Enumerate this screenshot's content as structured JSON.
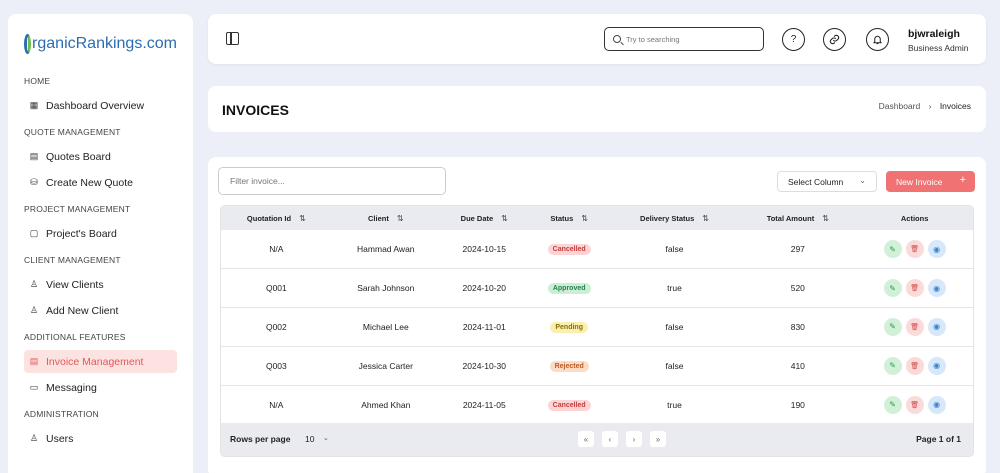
{
  "brand": {
    "logo_text": "rganicRankings.com"
  },
  "sidebar": {
    "sections": [
      {
        "title": "HOME",
        "items": [
          {
            "label": "Dashboard Overview",
            "icon": "grid-icon"
          }
        ]
      },
      {
        "title": "QUOTE MANAGEMENT",
        "items": [
          {
            "label": "Quotes Board",
            "icon": "board-icon"
          },
          {
            "label": "Create New Quote",
            "icon": "database-icon"
          }
        ]
      },
      {
        "title": "PROJECT MANAGEMENT",
        "items": [
          {
            "label": "Project's Board",
            "icon": "clipboard-icon"
          }
        ]
      },
      {
        "title": "CLIENT MANAGEMENT",
        "items": [
          {
            "label": "View Clients",
            "icon": "user-icon"
          },
          {
            "label": "Add New Client",
            "icon": "user-plus-icon"
          }
        ]
      },
      {
        "title": "ADDITIONAL FEATURES",
        "items": [
          {
            "label": "Invoice Management",
            "icon": "invoice-icon",
            "active": true
          },
          {
            "label": "Messaging",
            "icon": "message-icon"
          }
        ]
      },
      {
        "title": "ADMINISTRATION",
        "items": [
          {
            "label": "Users",
            "icon": "users-icon"
          }
        ]
      }
    ]
  },
  "header": {
    "search_placeholder": "Try to searching",
    "user_name": "bjwraleigh",
    "user_role": "Business Admin"
  },
  "page": {
    "title": "INVOICES",
    "breadcrumb": [
      "Dashboard",
      "Invoices"
    ]
  },
  "toolbar": {
    "filter_placeholder": "Filter invoice...",
    "select_column": "Select Column",
    "new_invoice": "New Invoice"
  },
  "table": {
    "columns": [
      "Quotation Id",
      "Client",
      "Due Date",
      "Status",
      "Delivery Status",
      "Total Amount",
      "Actions"
    ],
    "rows": [
      {
        "id": "N/A",
        "client": "Hammad Awan",
        "due": "2024-10-15",
        "status": "Cancelled",
        "delivery": "false",
        "total": "297"
      },
      {
        "id": "Q001",
        "client": "Sarah Johnson",
        "due": "2024-10-20",
        "status": "Approved",
        "delivery": "true",
        "total": "520"
      },
      {
        "id": "Q002",
        "client": "Michael Lee",
        "due": "2024-11-01",
        "status": "Pending",
        "delivery": "false",
        "total": "830"
      },
      {
        "id": "Q003",
        "client": "Jessica Carter",
        "due": "2024-10-30",
        "status": "Rejected",
        "delivery": "false",
        "total": "410"
      },
      {
        "id": "N/A",
        "client": "Ahmed Khan",
        "due": "2024-11-05",
        "status": "Cancelled",
        "delivery": "true",
        "total": "190"
      }
    ]
  },
  "status_colors": {
    "Cancelled": {
      "bg": "#fbd5d5",
      "fg": "#c43d3d"
    },
    "Approved": {
      "bg": "#cdeed6",
      "fg": "#23844a"
    },
    "Pending": {
      "bg": "#fbefb0",
      "fg": "#8a6d07"
    },
    "Rejected": {
      "bg": "#fbdcc6",
      "fg": "#c35a22"
    }
  },
  "pagination": {
    "rows_per_page_label": "Rows per page",
    "rows_per_page": "10",
    "page_info": "Page 1 of 1"
  },
  "colors": {
    "accent": "#f07272",
    "active_bg": "#fde2e2"
  }
}
